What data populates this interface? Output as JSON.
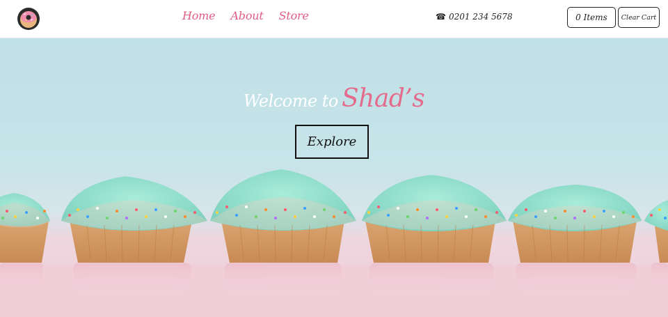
{
  "brand": {
    "logo_icon": "donut-icon",
    "colors": {
      "accent": "#e25d84",
      "brand_pink": "#e46b8c",
      "text": "#222222"
    }
  },
  "nav": {
    "links": [
      {
        "label": "Home"
      },
      {
        "label": "About"
      },
      {
        "label": "Store"
      }
    ],
    "phone": {
      "icon": "phone-icon",
      "glyph": "☎",
      "number": "0201 234 5678"
    },
    "cart": {
      "label": "0 Items"
    },
    "clear_cart": {
      "label": "Clear Cart"
    }
  },
  "hero": {
    "welcome_prefix": "Welcome to",
    "brand_name": "Shad’s",
    "cta_label": "Explore",
    "image": "cupcakes-with-sprinkles"
  }
}
